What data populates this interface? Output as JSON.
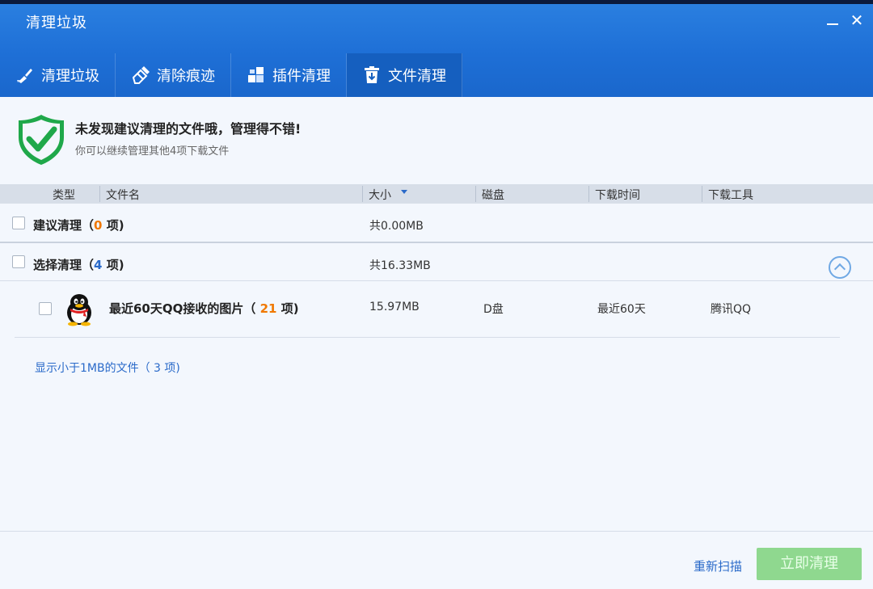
{
  "window": {
    "title": "清理垃圾",
    "minimize_icon": "minimize-icon",
    "close_label": "✕"
  },
  "tabs": [
    {
      "label": "清理垃圾",
      "icon": "broom-icon",
      "active": false
    },
    {
      "label": "清除痕迹",
      "icon": "eraser-icon",
      "active": false
    },
    {
      "label": "插件清理",
      "icon": "plugin-icon",
      "active": false
    },
    {
      "label": "文件清理",
      "icon": "trash-download-icon",
      "active": true
    }
  ],
  "banner": {
    "title": "未发现建议清理的文件哦，管理得不错!",
    "subtitle": "你可以继续管理其他4项下载文件",
    "icon": "shield-check-icon"
  },
  "columns": {
    "type": "类型",
    "filename": "文件名",
    "size": "大小",
    "disk": "磁盘",
    "download_time": "下载时间",
    "download_tool": "下载工具"
  },
  "groups": {
    "suggested": {
      "label": "建议清理",
      "open_paren": "（",
      "count": "0",
      "count_suffix": " 项)",
      "total": "共0.00MB"
    },
    "selected": {
      "label": "选择清理",
      "open_paren": "（",
      "count": "4",
      "count_suffix": " 项)",
      "total": "共16.33MB"
    }
  },
  "items": [
    {
      "name": "最近60天QQ接收的图片",
      "open_paren": "（ ",
      "count": "21",
      "count_suffix": " 项)",
      "size": "15.97MB",
      "disk": "D盘",
      "time": "最近60天",
      "tool": "腾讯QQ",
      "icon": "qq-penguin-icon"
    }
  ],
  "show_small": "显示小于1MB的文件（ 3 项)",
  "footer": {
    "rescan": "重新扫描",
    "clean": "立即清理"
  },
  "colors": {
    "header": "#1e6fd6",
    "active_tab": "#155fbf",
    "accent_blue": "#2a6ac9",
    "count_orange": "#f07800",
    "clean_button": "#8fd88f"
  }
}
